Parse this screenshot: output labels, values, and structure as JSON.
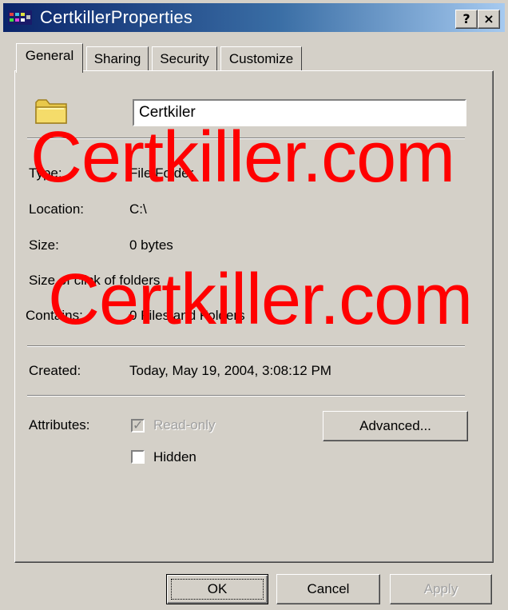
{
  "window": {
    "title": "CertkillerProperties",
    "help_label": "?",
    "close_label": "×"
  },
  "tabs": [
    {
      "label": "General",
      "active": true
    },
    {
      "label": "Sharing",
      "active": false
    },
    {
      "label": "Security",
      "active": false
    },
    {
      "label": "Customize",
      "active": false
    }
  ],
  "general": {
    "folder_name": "Certkiler",
    "folder_icon": "folder-icon",
    "rows": {
      "type_label": "Type:",
      "type_value": "File Folder",
      "location_label": "Location:",
      "location_value": "C:\\",
      "size_label": "Size:",
      "size_value": "0 bytes",
      "size_on_disk_label": "Size of click of folders",
      "contains_label": "Contains:",
      "contains_value": "0 Files and Folders",
      "created_label": "Created:",
      "created_value": "Today, May 19, 2004, 3:08:12 PM",
      "attributes_label": "Attributes:"
    },
    "attributes": {
      "readonly_label": "Read-only",
      "readonly_checked": true,
      "readonly_disabled": true,
      "hidden_label": "Hidden",
      "hidden_checked": false,
      "advanced_label": "Advanced..."
    }
  },
  "footer": {
    "ok_label": "OK",
    "cancel_label": "Cancel",
    "apply_label": "Apply"
  },
  "watermark": {
    "line1": "Certkiller.com",
    "line2": "Certkiller.com",
    "color": "#ff0000"
  },
  "colors": {
    "titlebar_start": "#0a246a",
    "titlebar_end": "#a6caf0",
    "face": "#d4d0c8"
  }
}
